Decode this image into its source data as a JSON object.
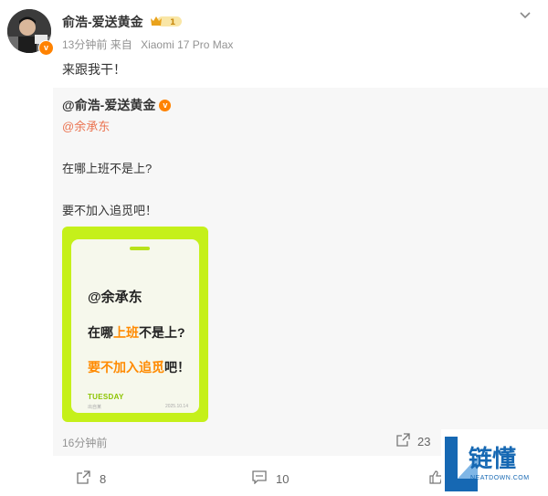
{
  "post": {
    "author": "俞浩-爱送黄金",
    "vip_level": "1",
    "time": "13分钟前",
    "source_prefix": "来自",
    "device": "Xiaomi 17 Pro Max",
    "text": "来跟我干！"
  },
  "repost": {
    "author": "@俞浩-爱送黄金",
    "mention": "@余承东",
    "line1": "在哪上班不是上?",
    "line2": "要不加入追觅吧！",
    "image": {
      "title": "@余承东",
      "t2_pre": "在哪",
      "t2_hl": "上班",
      "t2_post": "不是上?",
      "t3_hl": "要不加入追觅",
      "t3_post": "吧！",
      "day": "TUESDAY",
      "small_left": "出自某",
      "date": "2025.10.14"
    },
    "time": "16分钟前",
    "share_count": "23"
  },
  "actions": {
    "share_count": "8",
    "comment_count": "10"
  },
  "watermark": {
    "text": "链懂",
    "sub": "NEATDOWN.COM"
  },
  "colors": {
    "verify": "#ff8200",
    "mention": "#eb7350",
    "card_green": "#c5f01a",
    "highlight": "#ff8a00"
  },
  "icons": [
    "chevron-down-icon",
    "share-icon",
    "comment-icon",
    "like-icon",
    "verified-icon",
    "vip-crown-icon"
  ]
}
